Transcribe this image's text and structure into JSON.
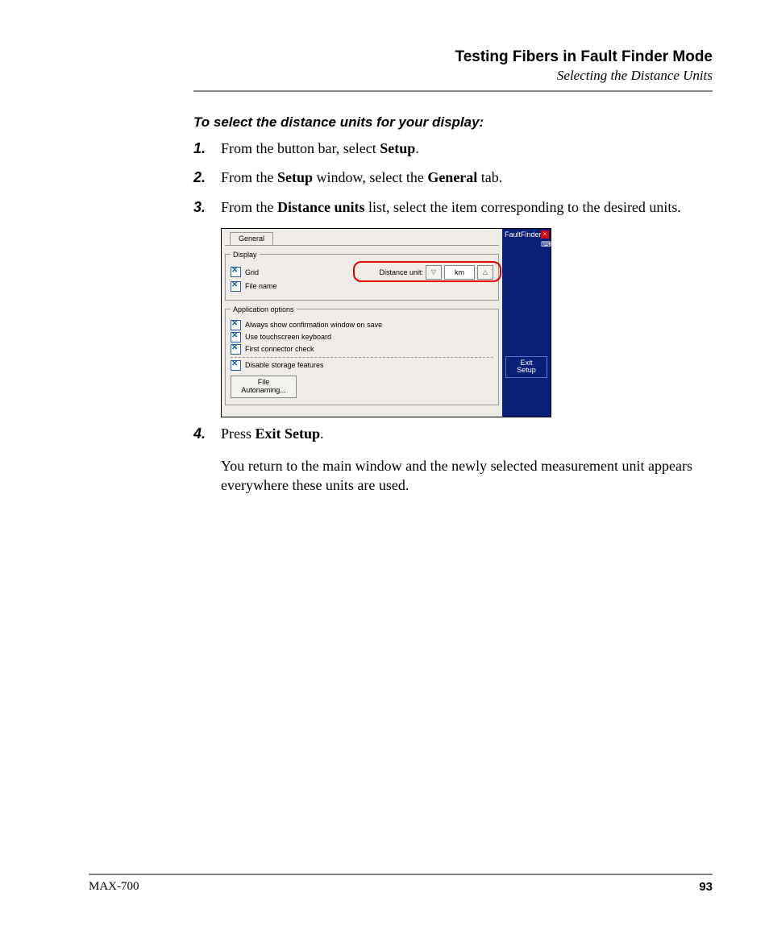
{
  "header": {
    "title": "Testing Fibers in Fault Finder Mode",
    "subtitle": "Selecting the Distance Units"
  },
  "intro": "To select the distance units for your display:",
  "steps": [
    {
      "num": "1.",
      "pre": "From the button bar, select ",
      "b1": "Setup",
      "post": "."
    },
    {
      "num": "2.",
      "pre": "From the ",
      "b1": "Setup",
      "mid": " window, select the ",
      "b2": "General",
      "post": " tab."
    },
    {
      "num": "3.",
      "pre": "From the ",
      "b1": "Distance units",
      "post": " list, select the item corresponding to the desired units."
    },
    {
      "num": "4.",
      "pre": "Press ",
      "b1": "Exit Setup",
      "post": "."
    }
  ],
  "after": "You return to the main window and the newly selected measurement unit appears everywhere these units are used.",
  "shot": {
    "tab": "General",
    "group_display": "Display",
    "cb_grid": "Grid",
    "cb_filename": "File name",
    "du_label": "Distance unit:",
    "du_value": "km",
    "group_app": "Application options",
    "cb_confirm": "Always show confirmation window on save",
    "cb_touch": "Use touchscreen keyboard",
    "cb_first": "First connector check",
    "cb_storage": "Disable storage features",
    "file_btn_l1": "File",
    "file_btn_l2": "Autonaming...",
    "side_title": "FaultFinder",
    "exit_l1": "Exit",
    "exit_l2": "Setup"
  },
  "footer": {
    "left": "MAX-700",
    "right": "93"
  }
}
